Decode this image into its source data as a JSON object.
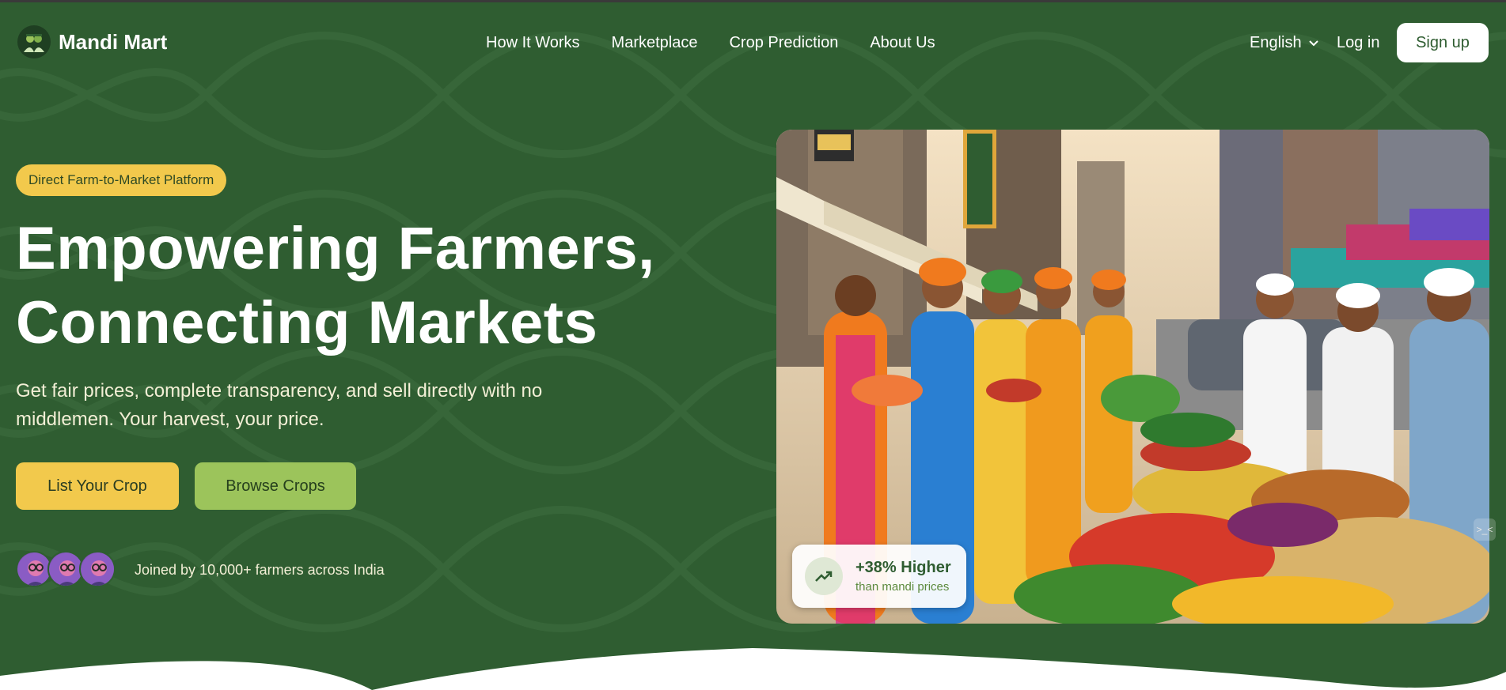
{
  "brand": {
    "name": "Mandi Mart",
    "logo_icon": "farmer-logo-icon"
  },
  "nav": {
    "links": [
      "How It Works",
      "Marketplace",
      "Crop Prediction",
      "About Us"
    ],
    "language": "English",
    "login": "Log in",
    "signup": "Sign up"
  },
  "hero": {
    "badge": "Direct Farm-to-Market Platform",
    "headline_line1": "Empowering Farmers,",
    "headline_line2": "Connecting Markets",
    "subtext": "Get fair prices, complete transparency, and sell directly with no middlemen. Your harvest, your price.",
    "primary_button": "List Your Crop",
    "secondary_button": "Browse Crops",
    "joined_text": "Joined by 10,000+ farmers across India",
    "stat_value": "+38% Higher",
    "stat_label": "than mandi prices",
    "side_handle": ">_<"
  },
  "colors": {
    "background": "#2f5d31",
    "accent_yellow": "#f2c94c",
    "accent_green": "#9cc45b",
    "text_cream": "#f3efd6"
  }
}
